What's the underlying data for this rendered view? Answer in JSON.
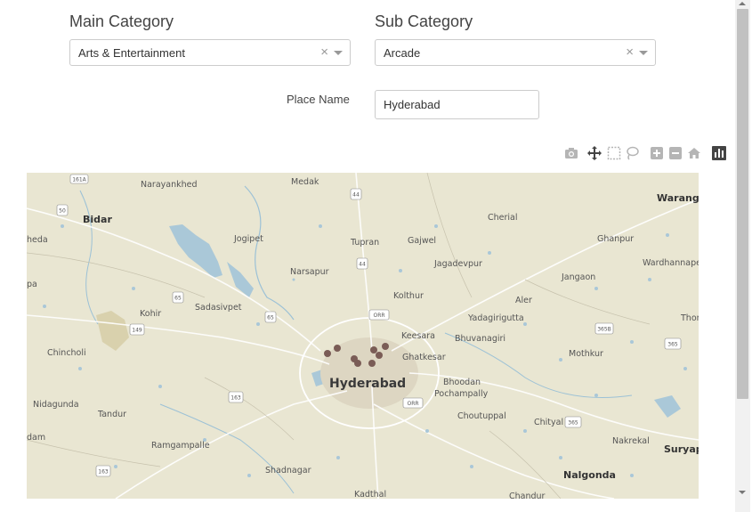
{
  "main_category": {
    "label": "Main Category",
    "value": "Arts & Entertainment",
    "clear_glyph": "×"
  },
  "sub_category": {
    "label": "Sub Category",
    "value": "Arcade",
    "clear_glyph": "×"
  },
  "place_name": {
    "label": "Place Name",
    "value": "Hyderabad"
  },
  "toolbar_icons": [
    "camera-icon",
    "pan-icon",
    "box-select-icon",
    "lasso-select-icon",
    "zoom-in-icon",
    "zoom-out-icon",
    "home-icon",
    "plotly-logo-icon"
  ],
  "map": {
    "markers_color": "#7a5c56",
    "labels": {
      "narayankhed": "Narayankhed",
      "medak": "Medak",
      "warangal": "Waranga",
      "bidar": "Bidar",
      "cherial": "Cherial",
      "heda": "heda",
      "jogipet": "Jogipet",
      "tupran": "Tupran",
      "gajwel": "Gajwel",
      "ghanpur": "Ghanpur",
      "wardhannape": "Wardhannape",
      "narsapur": "Narsapur",
      "jagadevpur": "Jagadevpur",
      "jangaon": "Jangaon",
      "pa": "pa",
      "sadasivpet": "Sadasivpet",
      "kolthur": "Kolthur",
      "aler": "Aler",
      "kohir": "Kohir",
      "yadagirigutta": "Yadagirigutta",
      "thor": "Thor",
      "keesara": "Keesara",
      "bhuvanagiri": "Bhuvanagiri",
      "chincholi": "Chincholi",
      "mothkur": "Mothkur",
      "ghatkesar": "Ghatkesar",
      "hyderabad": "Hyderabad",
      "bhoodan": "Bhoodan",
      "pochampally": "Pochampally",
      "nidagunda": "Nidagunda",
      "tandur": "Tandur",
      "choutuppal": "Choutuppal",
      "chityal": "Chityal",
      "dam": "dam",
      "nakrekal": "Nakrekal",
      "ramgampalle": "Ramgampalle",
      "suryap": "Suryap",
      "shadnagar": "Shadnagar",
      "nalgonda": "Nalgonda",
      "kadthal": "Kadthal",
      "chandur": "Chandur"
    },
    "shields": {
      "s161a": "161A",
      "s50": "50",
      "s44a": "44",
      "s44b": "44",
      "s65": "65",
      "s65b": "65",
      "s149": "149",
      "s163": "163",
      "s163b": "163",
      "s365b": "365B",
      "s365": "365",
      "s365c": "365",
      "orr1": "ORR",
      "orr2": "ORR"
    }
  }
}
